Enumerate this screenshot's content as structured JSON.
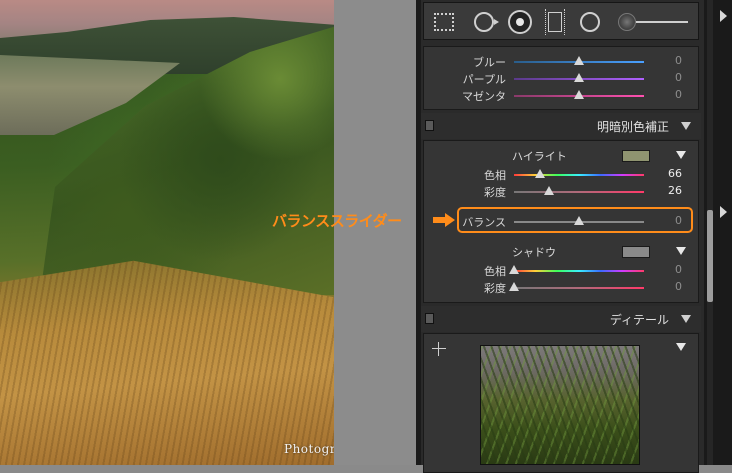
{
  "watermark": "PhotograFan.com",
  "toolstrip": {
    "tools": [
      "crop-overlay-icon",
      "spot-removal-icon",
      "red-eye-icon",
      "graduated-filter-icon",
      "radial-filter-icon",
      "adjustment-brush-icon"
    ]
  },
  "hsl": {
    "rows": [
      {
        "label": "ブルー",
        "value": "0",
        "position": 0.5
      },
      {
        "label": "パープル",
        "value": "0",
        "position": 0.5
      },
      {
        "label": "マゼンタ",
        "value": "0",
        "position": 0.5
      }
    ]
  },
  "split_toning": {
    "title": "明暗別色補正",
    "highlight": {
      "title": "ハイライト",
      "swatch_color": "#8f9470",
      "hue": {
        "label": "色相",
        "value": "66",
        "position": 0.2
      },
      "saturation": {
        "label": "彩度",
        "value": "26",
        "position": 0.27
      }
    },
    "balance": {
      "label": "バランス",
      "value": "0",
      "position": 0.5
    },
    "shadow": {
      "title": "シャドウ",
      "swatch_color": "#8a8a8a",
      "hue": {
        "label": "色相",
        "value": "0",
        "position": 0.0
      },
      "saturation": {
        "label": "彩度",
        "value": "0",
        "position": 0.0
      }
    }
  },
  "detail": {
    "title": "ディテール"
  },
  "callout": {
    "label": "バランススライダー",
    "color": "#ff8c1a"
  }
}
